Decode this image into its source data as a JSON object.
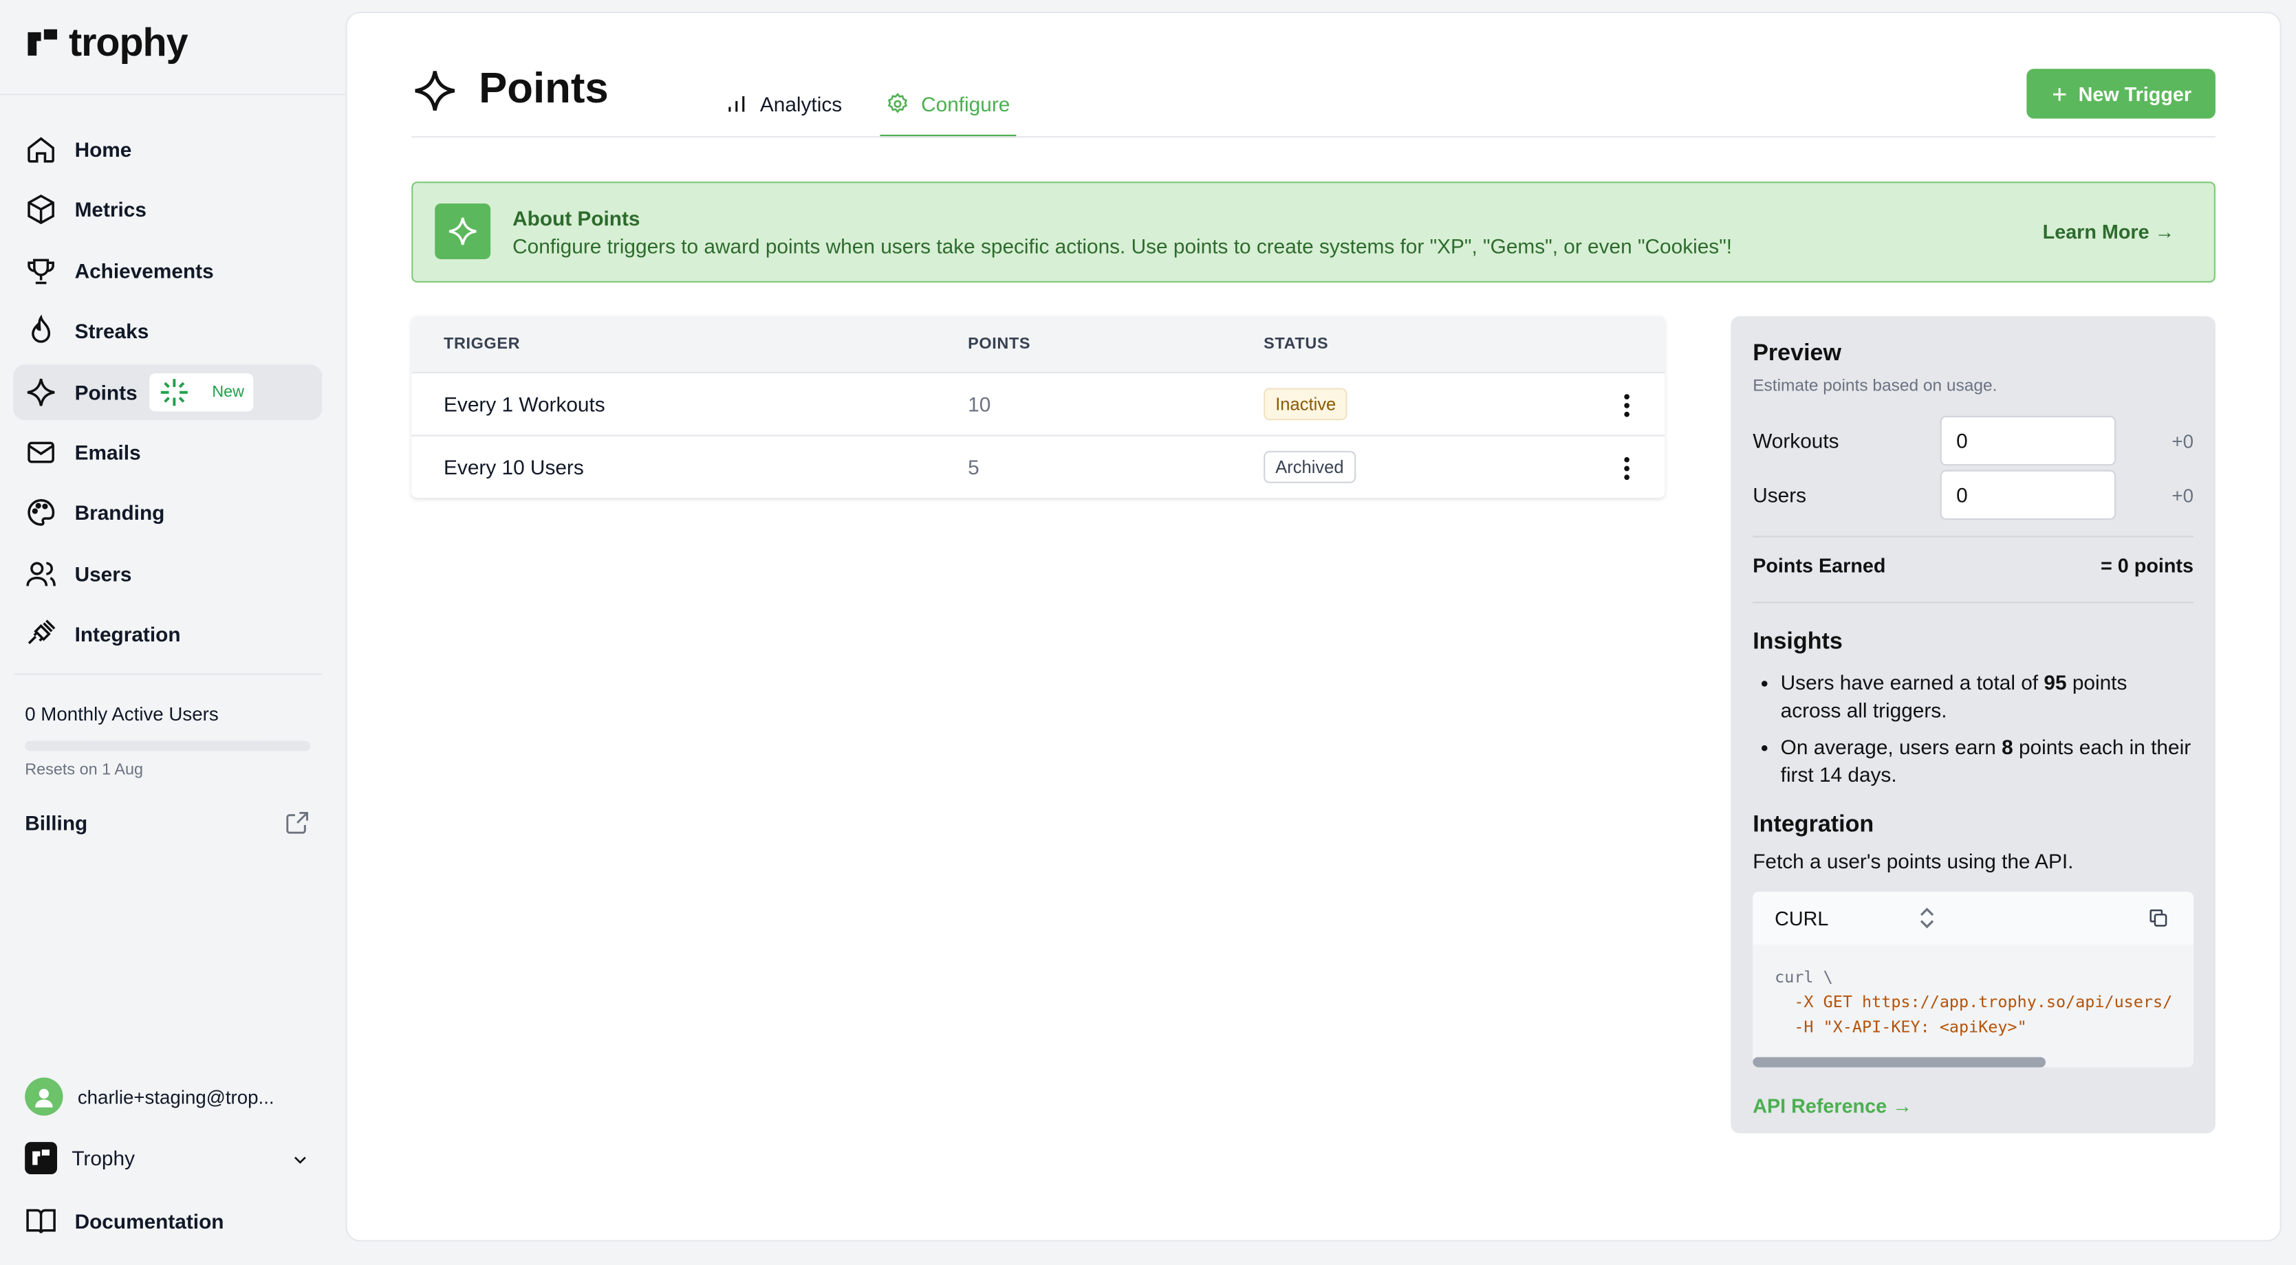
{
  "app": {
    "name": "trophy"
  },
  "sidebar": {
    "items": [
      {
        "label": "Home",
        "icon": "home-icon"
      },
      {
        "label": "Metrics",
        "icon": "cube-icon"
      },
      {
        "label": "Achievements",
        "icon": "trophy-icon"
      },
      {
        "label": "Streaks",
        "icon": "flame-icon"
      },
      {
        "label": "Points",
        "icon": "sparkle-icon",
        "badge": "New",
        "active": true
      },
      {
        "label": "Emails",
        "icon": "mail-icon"
      },
      {
        "label": "Branding",
        "icon": "palette-icon"
      },
      {
        "label": "Users",
        "icon": "users-icon"
      },
      {
        "label": "Integration",
        "icon": "plug-icon"
      }
    ],
    "usage": {
      "label": "0 Monthly Active Users",
      "progress": 0,
      "resets": "Resets on 1 Aug"
    },
    "billing_label": "Billing",
    "user_email": "charlie+staging@trop...",
    "org_name": "Trophy",
    "docs_label": "Documentation"
  },
  "header": {
    "title": "Points",
    "tabs": [
      {
        "label": "Analytics",
        "active": false
      },
      {
        "label": "Configure",
        "active": true
      }
    ],
    "new_trigger_label": "New Trigger"
  },
  "about": {
    "title": "About Points",
    "description": "Configure triggers to award points when users take specific actions. Use points to create systems for \"XP\", \"Gems\", or even \"Cookies\"!",
    "learn_more": "Learn More →"
  },
  "table": {
    "headers": [
      "TRIGGER",
      "POINTS",
      "STATUS"
    ],
    "rows": [
      {
        "trigger": "Every 1 Workouts",
        "points": "10",
        "status": "Inactive"
      },
      {
        "trigger": "Every 10 Users",
        "points": "5",
        "status": "Archived"
      }
    ]
  },
  "preview": {
    "title": "Preview",
    "subtitle": "Estimate points based on usage.",
    "inputs": [
      {
        "label": "Workouts",
        "value": "0",
        "delta": "+0"
      },
      {
        "label": "Users",
        "value": "0",
        "delta": "+0"
      }
    ],
    "earned_label": "Points Earned",
    "earned_value": "= 0 points",
    "insights_title": "Insights",
    "insights": [
      {
        "pre": "Users have earned a total of ",
        "bold": "95",
        "post": " points across all triggers."
      },
      {
        "pre": "On average, users earn ",
        "bold": "8",
        "post": " points each in their first 14 days."
      }
    ],
    "integration_title": "Integration",
    "integration_desc": "Fetch a user's points using the API.",
    "code_lang": "CURL",
    "code_lines": [
      "curl \\",
      "  -X GET https://app.trophy.so/api/users/",
      "  -H \"X-API-KEY: <apiKey>\""
    ],
    "api_reference": "API Reference →"
  },
  "colors": {
    "accent": "#5cb85c",
    "accent_text": "#4caf50",
    "banner_bg": "#d7efd4",
    "banner_text": "#2e6b2e"
  }
}
